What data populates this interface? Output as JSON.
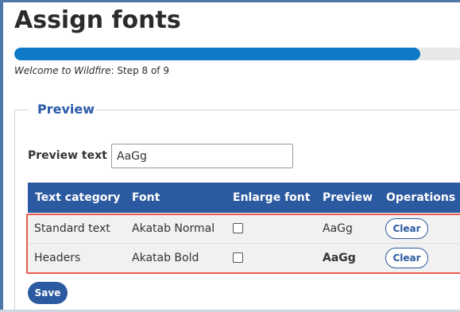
{
  "page": {
    "title": "Assign fonts",
    "progress_fraction": 0.889,
    "step_intro": "Welcome to Wildfire",
    "step_text": ": Step 8 of 9"
  },
  "preview_section": {
    "legend": "Preview",
    "preview_text_label": "Preview text",
    "preview_text_value": "AaGg"
  },
  "table": {
    "headers": {
      "text_category": "Text category",
      "font": "Font",
      "enlarge_font": "Enlarge font",
      "preview": "Preview",
      "operations": "Operations"
    },
    "rows": [
      {
        "text_category": "Standard text",
        "font": "Akatab Normal",
        "enlarge_font": false,
        "preview": "AaGg",
        "operation": "Clear"
      },
      {
        "text_category": "Headers",
        "font": "Akatab Bold",
        "enlarge_font": false,
        "preview": "AaGg",
        "operation": "Clear"
      }
    ]
  },
  "actions": {
    "save_label": "Save"
  },
  "colors": {
    "frame": "#4f77a8",
    "progress": "#0e79c9",
    "table_header": "#2b5aa0",
    "highlight": "#e85a4f"
  }
}
